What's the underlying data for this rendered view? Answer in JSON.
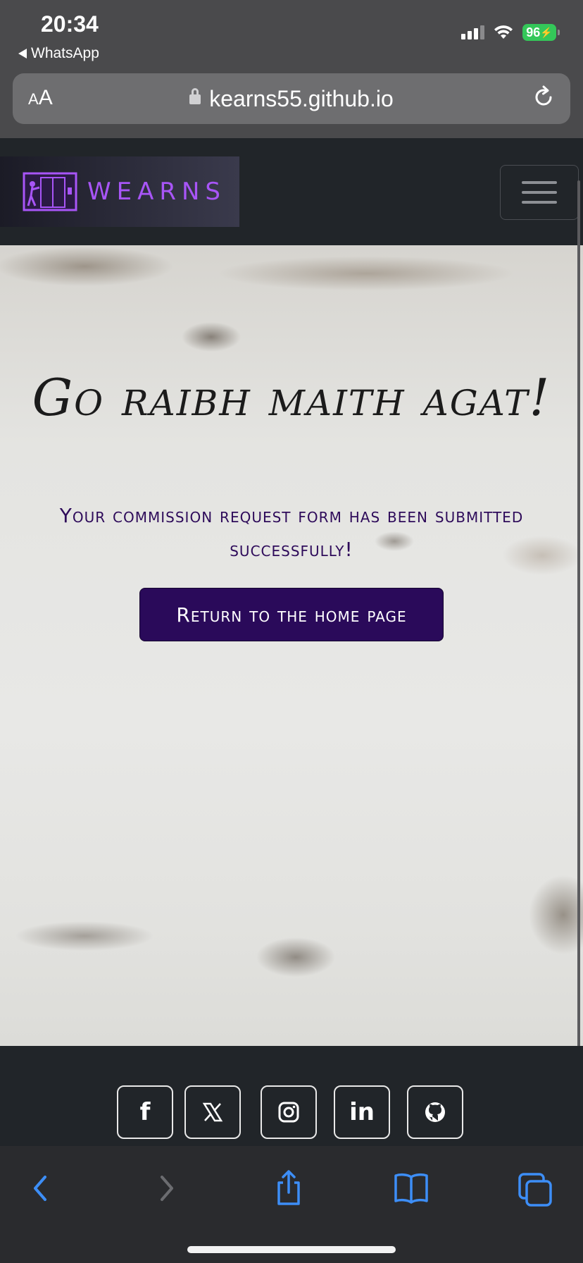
{
  "status_bar": {
    "time": "20:34",
    "back_app": "WhatsApp",
    "battery": "96"
  },
  "browser": {
    "text_size_small": "A",
    "text_size_large": "A",
    "url": "kearns55.github.io"
  },
  "site_nav": {
    "brand_name": "WEARNS"
  },
  "hero": {
    "title": "Go raibh maith agat!",
    "subtitle": "Your commission request form has been submitted successfully!",
    "button_label": "Return to the home page"
  },
  "footer": {
    "social_links": [
      {
        "name": "facebook",
        "glyph": "f"
      },
      {
        "name": "x",
        "glyph": "𝕏"
      },
      {
        "name": "instagram",
        "glyph": ""
      },
      {
        "name": "linkedin",
        "glyph": "in"
      },
      {
        "name": "github",
        "glyph": ""
      }
    ]
  },
  "colors": {
    "accent_purple": "#a855f7",
    "button_bg": "#2a0a5a",
    "subtitle_text": "#2e0b5a",
    "ios_blue": "#3d8ef7",
    "battery_green": "#34c759"
  }
}
